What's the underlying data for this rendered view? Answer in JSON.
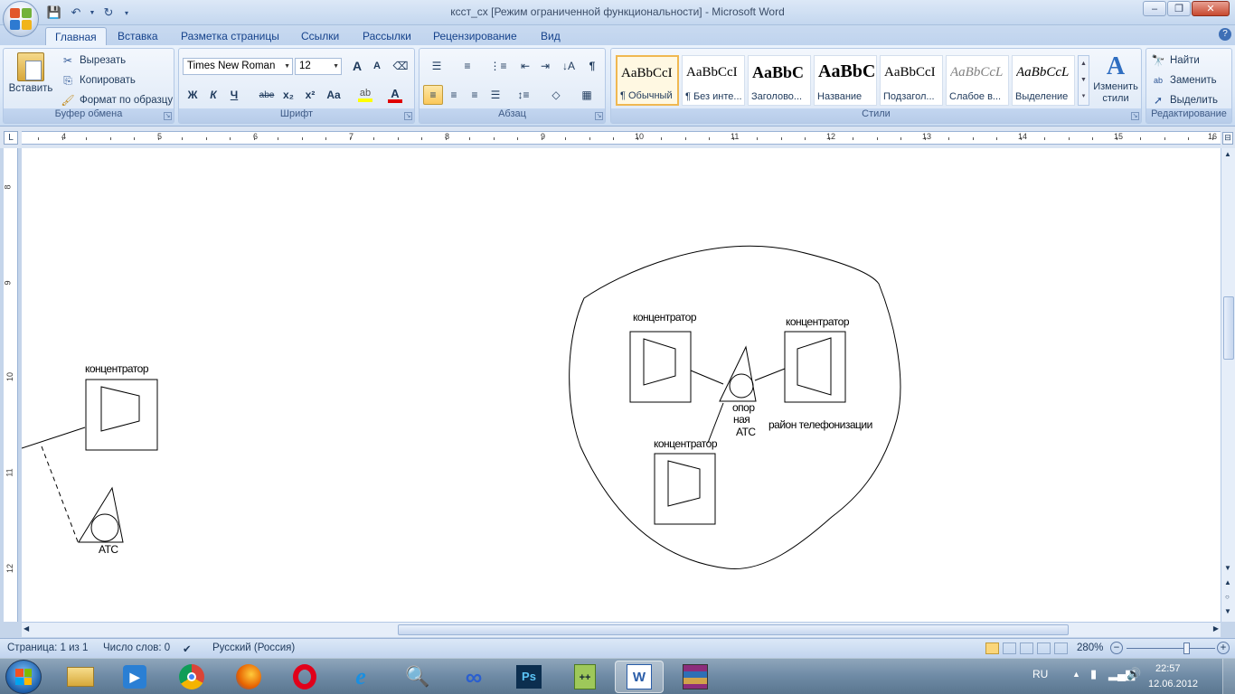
{
  "window": {
    "title": "ксст_сх [Режим ограниченной функциональности] - Microsoft Word",
    "minimize": "–",
    "maximize": "❐",
    "close": "✕"
  },
  "tabs": [
    {
      "label": "Главная",
      "active": true
    },
    {
      "label": "Вставка"
    },
    {
      "label": "Разметка страницы"
    },
    {
      "label": "Ссылки"
    },
    {
      "label": "Рассылки"
    },
    {
      "label": "Рецензирование"
    },
    {
      "label": "Вид"
    }
  ],
  "clipboard": {
    "paste": "Вставить",
    "cut": "Вырезать",
    "copy": "Копировать",
    "format_painter": "Формат по образцу",
    "label": "Буфер обмена"
  },
  "font": {
    "name": "Times New Roman",
    "size": "12",
    "label": "Шрифт",
    "bold": "Ж",
    "italic": "К",
    "underline": "Ч",
    "strike": "abe",
    "subscript": "x₂",
    "superscript": "x²",
    "change_case": "Aa",
    "grow": "A",
    "shrink": "A"
  },
  "paragraph": {
    "label": "Абзац",
    "pilcrow": "¶"
  },
  "styles": {
    "label": "Стили",
    "items": [
      {
        "sample": "AaBbCcI",
        "name": "¶ Обычный",
        "selected": true
      },
      {
        "sample": "AaBbCcI",
        "name": "¶ Без инте..."
      },
      {
        "sample": "AaBbC",
        "name": "Заголово..."
      },
      {
        "sample": "AaBbC",
        "name": "Название"
      },
      {
        "sample": "AaBbCcI",
        "name": "Подзагол..."
      },
      {
        "sample": "AaBbCcL",
        "name": "Слабое в..."
      },
      {
        "sample": "AaBbCcL",
        "name": "Выделение"
      }
    ],
    "change": "Изменить стили"
  },
  "editing": {
    "label": "Редактирование",
    "find": "Найти",
    "replace": "Заменить",
    "select": "Выделить"
  },
  "ruler": {
    "h_numbers": [
      "4",
      "5",
      "6",
      "7",
      "8",
      "9",
      "10",
      "11",
      "12",
      "13",
      "14",
      "15",
      "16"
    ],
    "v_numbers": [
      "8",
      "9",
      "10",
      "11",
      "12"
    ]
  },
  "diagram": {
    "left": {
      "hub_label": "концентратор",
      "atc_label": "АТС"
    },
    "district": {
      "hub_top_left": "концентратор",
      "hub_top_right": "концентратор",
      "hub_bottom": "концентратор",
      "center_atc_line1": "опор",
      "center_atc_line2": "ная",
      "center_atc_line3": "АТС",
      "district_label": "район телефонизации"
    }
  },
  "status": {
    "page": "Страница: 1 из 1",
    "words": "Число слов: 0",
    "language": "Русский (Россия)",
    "zoom": "280%"
  },
  "taskbar": {
    "lang": "RU",
    "time": "22:57",
    "date": "12.06.2012"
  }
}
